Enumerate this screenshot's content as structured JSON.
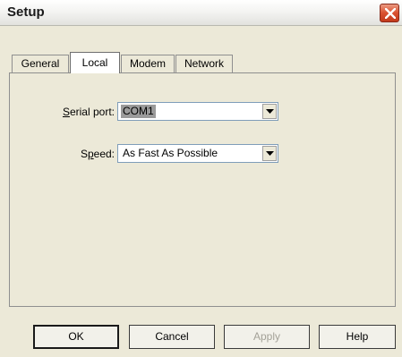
{
  "window": {
    "title": "Setup",
    "close_icon": "close-icon"
  },
  "tabs": [
    {
      "label": "General",
      "active": false
    },
    {
      "label": "Local",
      "active": true
    },
    {
      "label": "Modem",
      "active": false
    },
    {
      "label": "Network",
      "active": false
    }
  ],
  "local": {
    "serial_port": {
      "label_mnemonic": "S",
      "label_rest": "erial port:",
      "value": "COM1"
    },
    "speed": {
      "label_start": "S",
      "label_mnemonic": "p",
      "label_rest": "eed:",
      "value": "As Fast As Possible"
    }
  },
  "buttons": {
    "ok": "OK",
    "cancel": "Cancel",
    "apply": "Apply",
    "help": "Help"
  },
  "colors": {
    "dialog_bg": "#ece9d8",
    "close_button": "#d9502f",
    "selection_highlight": "#9a9a9a"
  }
}
